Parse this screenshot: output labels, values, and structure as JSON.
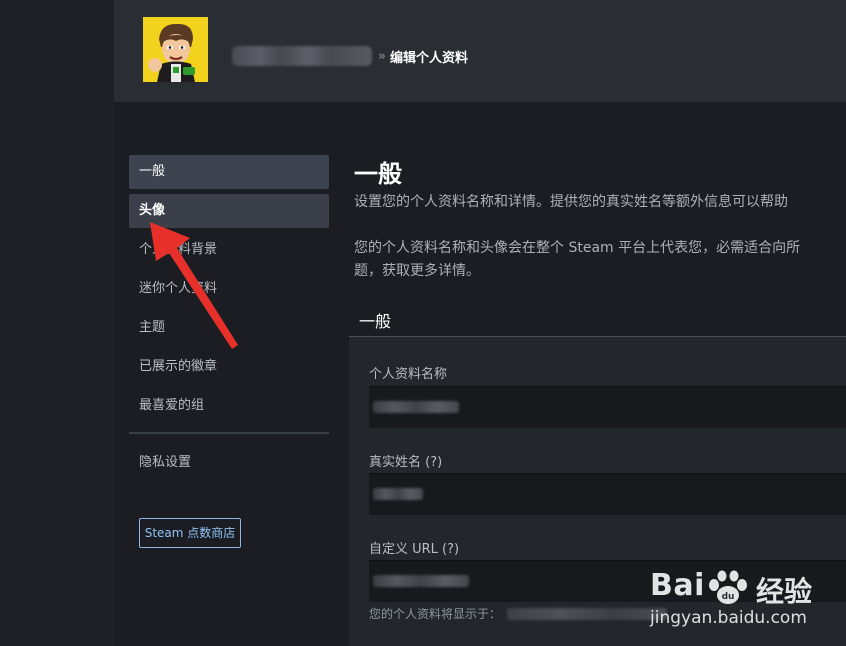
{
  "header": {
    "breadcrumb_separator": "»",
    "breadcrumb_current": "编辑个人资料"
  },
  "sidebar": {
    "items": [
      {
        "label": "一般"
      },
      {
        "label": "头像"
      },
      {
        "label": "个人资料背景"
      },
      {
        "label": "迷你个人资料"
      },
      {
        "label": "主题"
      },
      {
        "label": "已展示的徽章"
      },
      {
        "label": "最喜爱的组"
      }
    ],
    "privacy_label": "隐私设置",
    "store_button_label": "Steam 点数商店"
  },
  "main": {
    "title": "一般",
    "desc_line1": "设置您的个人资料名称和详情。提供您的真实姓名等额外信息可以帮助",
    "desc_line2": "您的个人资料名称和头像会在整个 Steam 平台上代表您，必需适合向所",
    "desc_line3": "题，获取更多详情。",
    "section_title": "一般",
    "fields": [
      {
        "label": "个人资料名称"
      },
      {
        "label": "真实姓名 (?)"
      },
      {
        "label": "自定义 URL (?)"
      }
    ],
    "url_hint": "您的个人资料将显示于："
  },
  "watermark": {
    "brand": "Bai",
    "brand_suffix": "经验",
    "url": "jingyan.baidu.com"
  },
  "colors": {
    "background": "#1b1d22",
    "header": "#2a2d33",
    "nav_active": "#3d4450",
    "accent_blue": "#8fc2f5",
    "annotation_arrow": "#e8302a"
  }
}
